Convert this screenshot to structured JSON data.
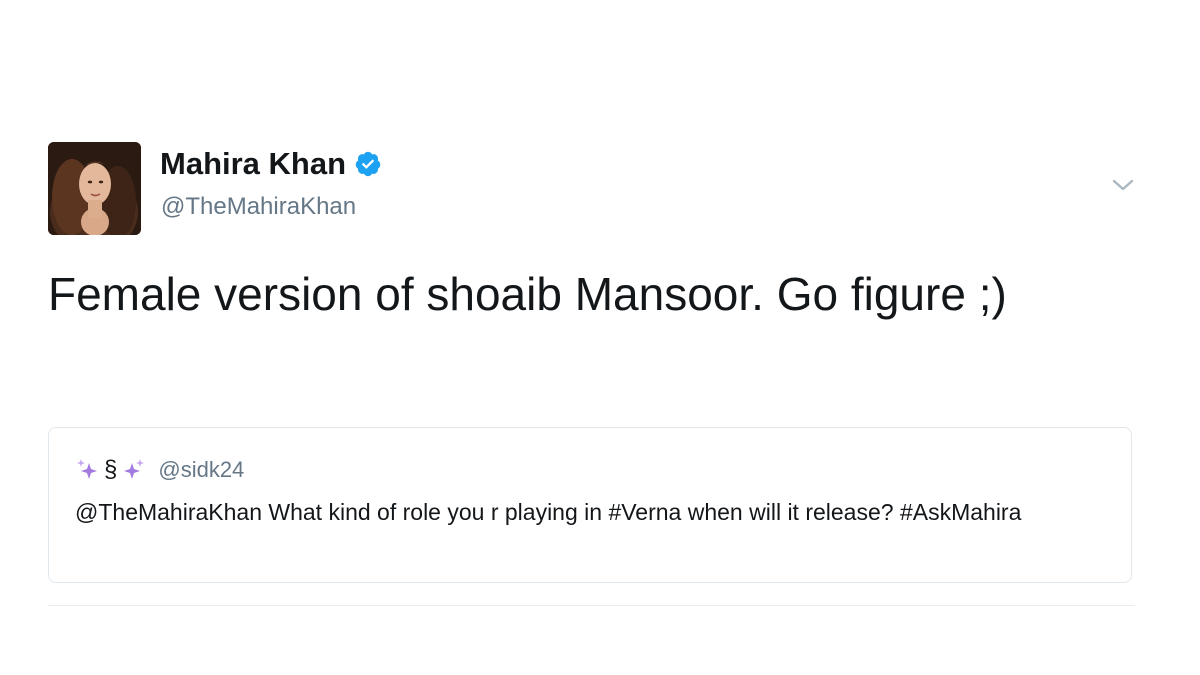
{
  "tweet": {
    "author": {
      "display_name": "Mahira Khan",
      "handle": "@TheMahiraKhan",
      "verified": true,
      "avatar_icon": "profile-photo"
    },
    "text": "Female version of shoaib Mansoor. Go figure ;)",
    "menu_icon": "chevron-down-icon"
  },
  "quoted_tweet": {
    "display_name_symbol": "§",
    "display_name_icon": "sparkles-icon",
    "handle": "@sidk24",
    "text": "@TheMahiraKhan What kind of role you r playing in #Verna when will it release? #AskMahira"
  },
  "colors": {
    "verified_blue": "#1da1f2",
    "text_primary": "#14171a",
    "text_secondary": "#657786",
    "border": "#e1e8ed",
    "sparkle_purple": "#a27be0"
  }
}
